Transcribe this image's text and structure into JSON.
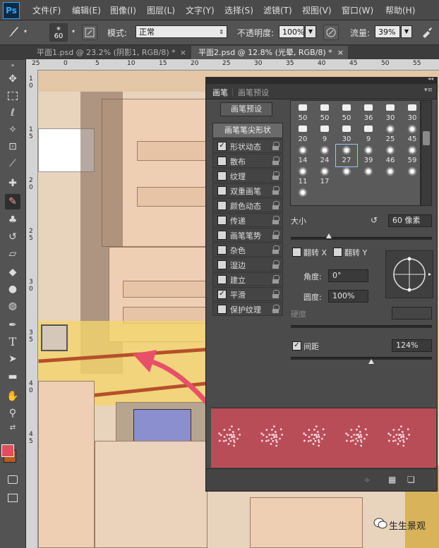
{
  "app": {
    "logo": "Ps"
  },
  "menu": [
    {
      "label": "文件(F)"
    },
    {
      "label": "编辑(E)"
    },
    {
      "label": "图像(I)"
    },
    {
      "label": "图层(L)"
    },
    {
      "label": "文字(Y)"
    },
    {
      "label": "选择(S)"
    },
    {
      "label": "滤镜(T)"
    },
    {
      "label": "视图(V)"
    },
    {
      "label": "窗口(W)"
    },
    {
      "label": "帮助(H)"
    }
  ],
  "options": {
    "brush_size": "60",
    "mode_label": "模式:",
    "mode_value": "正常",
    "opacity_label": "不透明度:",
    "opacity_value": "100%",
    "flow_label": "流量:",
    "flow_value": "39%"
  },
  "tabs": [
    {
      "label": "平面1.psd @ 23.2% (阴影1, RGB/8) *",
      "close": "×"
    },
    {
      "label": "平面2.psd @ 12.8% (光晕, RGB/8) *",
      "close": "×"
    }
  ],
  "ruler_top": [
    "25",
    "0",
    "5",
    "10",
    "15",
    "20",
    "25",
    "30",
    "35",
    "40",
    "45",
    "50",
    "55",
    "60"
  ],
  "ruler_left": [
    "1",
    "0",
    "1",
    "5",
    "2",
    "0",
    "2",
    "5",
    "3",
    "0",
    "3",
    "5",
    "4",
    "0",
    "4",
    "5"
  ],
  "panel": {
    "tabs": [
      "画笔",
      "画笔预设"
    ],
    "preset_button": "画笔预设",
    "tip_shape_label": "画笔笔尖形状",
    "options": [
      {
        "label": "形状动态",
        "checked": "✓"
      },
      {
        "label": "散布",
        "checked": ""
      },
      {
        "label": "纹理",
        "checked": ""
      },
      {
        "label": "双重画笔",
        "checked": ""
      },
      {
        "label": "颜色动态",
        "checked": ""
      },
      {
        "label": "传递",
        "checked": ""
      },
      {
        "label": "画笔笔势",
        "checked": ""
      },
      {
        "label": "杂色",
        "checked": ""
      },
      {
        "label": "湿边",
        "checked": ""
      },
      {
        "label": "建立",
        "checked": ""
      },
      {
        "label": "平滑",
        "checked": "✓"
      },
      {
        "label": "保护纹理",
        "checked": ""
      }
    ],
    "tips": [
      "50",
      "50",
      "50",
      "36",
      "30",
      "30",
      "20",
      "9",
      "30",
      "9",
      "25",
      "45",
      "14",
      "24",
      "27",
      "39",
      "46",
      "59",
      "11",
      "17",
      "",
      "",
      "",
      "",
      ""
    ],
    "size_label": "大小",
    "size_value": "60 像素",
    "flip_x": "翻转 X",
    "flip_y": "翻转 Y",
    "angle_label": "角度:",
    "angle_value": "0°",
    "roundness_label": "圆度:",
    "roundness_value": "100%",
    "hardness_label": "硬度",
    "spacing_label": "间距",
    "spacing_checked": "✓",
    "spacing_value": "124%",
    "size_slider": 0.27,
    "spacing_slider": 0.57
  },
  "colors": {
    "foreground": "#e0505a",
    "background": "#b85a1c",
    "preview_bg": "#b84d58",
    "arrow": "#e8506a"
  },
  "watermark": {
    "text": "生生景观"
  }
}
